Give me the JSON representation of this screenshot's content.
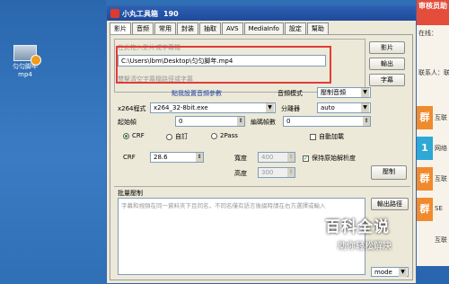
{
  "desktop": {
    "icon_name": "匀匀脚年",
    "icon_ext": "mp4"
  },
  "window": {
    "title": "小丸工具箱",
    "version": "190"
  },
  "tabs": [
    "影片",
    "音频",
    "常用",
    "封装",
    "抽取",
    "AVS",
    "MediaInfo",
    "設定",
    "幫助"
  ],
  "video": {
    "input_hint": "在此拖入影片或字幕檔",
    "input_path": "C:\\Users\\lbm\\Desktop\\匀匀脚年.mp4",
    "subtitle_hint": "雙擊清空字幕檔路徑或字幕",
    "btn_video": "影片",
    "btn_output": "輸出",
    "btn_subtitle": "字幕"
  },
  "params": {
    "link_label": "點我設置音頻參數",
    "audio_mode_label": "音頻模式",
    "audio_mode_value": "壓制音頻",
    "x264_label": "x264程式",
    "x264_value": "x264_32-8bit.exe",
    "splitter_label": "分離器",
    "splitter_value": "auto",
    "start_frame_label": "起始幀",
    "start_frame_value": "0",
    "encode_frames_label": "編碼幀數",
    "encode_frames_value": "0",
    "mode_crf": "CRF",
    "mode_custom": "自訂",
    "mode_2pass": "2Pass",
    "auto_subs_label": "自動加載",
    "crf_label": "CRF",
    "crf_value": "28.6",
    "width_label": "寬度",
    "width_value": "400",
    "height_label": "高度",
    "height_value": "300",
    "keep_res_label": "保持原始解析度",
    "btn_encode": "壓制"
  },
  "batch": {
    "title": "批量壓制",
    "hint": "字幕和視頻在同一資料夾下且同名，不同名僅有語言後綴時請在右方選擇或輸入",
    "btn_output": "輸出路徑",
    "select_value": "mode"
  },
  "watermark": {
    "main": "百科全说",
    "sub": "助你轻松解决"
  },
  "strip": {
    "top_text": "审核员助",
    "online_text": "在线：",
    "contact_text": "联系人：联系",
    "items": [
      "群",
      "1",
      "群",
      "群"
    ],
    "side_labels": [
      "互联",
      "网络",
      "互联",
      "SE",
      "互联"
    ]
  }
}
